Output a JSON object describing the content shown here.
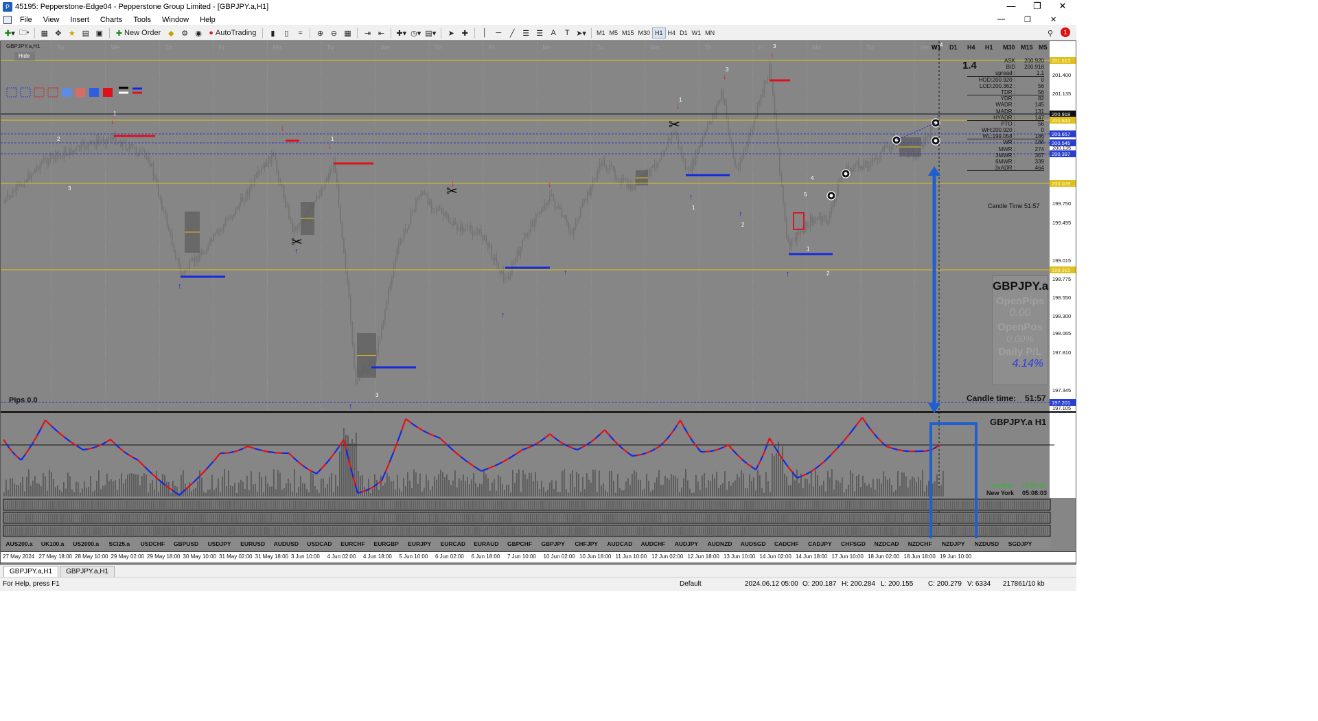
{
  "window": {
    "title": "45195: Pepperstone-Edge04 - Pepperstone Group Limited - [GBPJPY.a,H1]"
  },
  "menu": [
    "File",
    "View",
    "Insert",
    "Charts",
    "Tools",
    "Window",
    "Help"
  ],
  "toolbar": {
    "new_order": "New Order",
    "autotrading": "AutoTrading",
    "timeframes": [
      "M1",
      "M5",
      "M15",
      "M30",
      "H1",
      "H4",
      "D1",
      "W1",
      "MN"
    ],
    "active_timeframe": "H1"
  },
  "chart": {
    "symbol_label": "GBPJPY.a,H1",
    "hide_button": "Hide",
    "day_labels": [
      "Tu",
      "We",
      "Th",
      "Fr",
      "Mo",
      "Tu",
      "We",
      "Th",
      "Fr",
      "Mo",
      "Tu",
      "We",
      "Th",
      "Fr",
      "Mo",
      "Tu",
      "We"
    ],
    "price_axis": [
      "201.400",
      "201.135",
      "200.655",
      "200.135",
      "199.750",
      "199.495",
      "199.015",
      "198.775",
      "198.550",
      "198.300",
      "198.065",
      "197.810",
      "197.345",
      "197.105"
    ],
    "price_tags": [
      {
        "text": "201.613",
        "color": "#e0c020"
      },
      {
        "text": "200.918",
        "color": "#101010"
      },
      {
        "text": "200.843",
        "color": "#e0c020"
      },
      {
        "text": "200.657",
        "color": "#2a3fd0"
      },
      {
        "text": "200.545",
        "color": "#2a3fd0"
      },
      {
        "text": "200.397",
        "color": "#2a3fd0"
      },
      {
        "text": "200.028",
        "color": "#e0c020"
      },
      {
        "text": "198.915",
        "color": "#e0c020"
      },
      {
        "text": "197.201",
        "color": "#2a3fd0"
      }
    ],
    "tf_buttons": [
      "W1",
      "D1",
      "H4",
      "H1",
      "M30",
      "M15",
      "M5"
    ],
    "spread_big": "1.4",
    "info_rows": [
      [
        "ASK",
        "200.920"
      ],
      [
        "BID",
        "200.918"
      ],
      [
        "spread :",
        "1.1"
      ],
      [
        "HOD:200.920 :",
        "0"
      ],
      [
        "LOD:200.362 :",
        "56"
      ],
      [
        "TDR :",
        "56"
      ],
      [
        "YDR :",
        "82"
      ],
      [
        "WADR :",
        "145"
      ],
      [
        "MADR :",
        "131"
      ],
      [
        "HYADR :",
        "147"
      ],
      [
        "PTO :",
        "56"
      ],
      [
        "WH:200.920 :",
        "0"
      ],
      [
        "WL:199.058 :",
        "186"
      ],
      [
        "WR :",
        "186"
      ],
      [
        "MWR :",
        "274"
      ],
      [
        "3MWR :",
        "367"
      ],
      [
        "6MWR :",
        "339"
      ],
      [
        "3xADR :",
        "464"
      ]
    ],
    "candle_time_small": "Candle Time   51:57",
    "panel": {
      "symbol": "GBPJPY.a",
      "open_pips_label": "OpenPips",
      "open_pips": "0.00",
      "open_pos_label": "OpenPos",
      "open_pos": "0.00%",
      "daily_pl_label": "Daily P/L",
      "daily_pl": "4.14%"
    },
    "pips_label": "Pips 0.0",
    "candle_time_label": "Candle time:",
    "candle_time": "51:57",
    "sub_title": "GBPJPY.a  H1",
    "london_label": "* London",
    "london_time": "10:08:03",
    "newyork_label": "New York",
    "newyork_time": "05:08:03",
    "pairs": [
      "AUS200.a",
      "UK100.a",
      "US2000.a",
      "SCI25.a",
      "USDCHF",
      "GBPUSD",
      "USDJPY",
      "EURUSD",
      "AUDUSD",
      "USDCAD",
      "EURCHF",
      "EURGBP",
      "EURJPY",
      "EURCAD",
      "EURAUD",
      "GBPCHF",
      "GBPJPY",
      "CHFJPY",
      "AUDCAD",
      "AUDCHF",
      "AUDJPY",
      "AUDNZD",
      "AUDSGD",
      "CADCHF",
      "CADJPY",
      "CHFSGD",
      "NZDCAD",
      "NZDCHF",
      "NZDJPY",
      "NZDUSD",
      "SGDJPY"
    ],
    "time_axis": [
      "27 May 2024",
      "27 May 18:00",
      "28 May 10:00",
      "29 May 02:00",
      "29 May 18:00",
      "30 May 10:00",
      "31 May 02:00",
      "31 May 18:00",
      "3 Jun 10:00",
      "4 Jun 02:00",
      "4 Jun 18:00",
      "5 Jun 10:00",
      "6 Jun 02:00",
      "6 Jun 18:00",
      "7 Jun 10:00",
      "10 Jun 02:00",
      "10 Jun 18:00",
      "11 Jun 10:00",
      "12 Jun 02:00",
      "12 Jun 18:00",
      "13 Jun 10:00",
      "14 Jun 02:00",
      "14 Jun 18:00",
      "17 Jun 10:00",
      "18 Jun 02:00",
      "18 Jun 18:00",
      "19 Jun 10:00"
    ],
    "labels_numbers": [
      "1",
      "2",
      "3",
      "1",
      "1",
      "3",
      "1",
      "2",
      "4",
      "3",
      "5",
      "1",
      "2",
      "3",
      "4",
      "1",
      "2"
    ]
  },
  "tabs": [
    "GBPJPY.a,H1",
    "GBPJPY.a,H1"
  ],
  "status": {
    "help": "For Help, press F1",
    "profile": "Default",
    "datetime": "2024.06.12 05:00",
    "open": "O: 200.187",
    "high": "H: 200.284",
    "low": "L: 200.155",
    "close": "C: 200.279",
    "volume": "V: 6334",
    "traffic": "217861/10 kb"
  }
}
